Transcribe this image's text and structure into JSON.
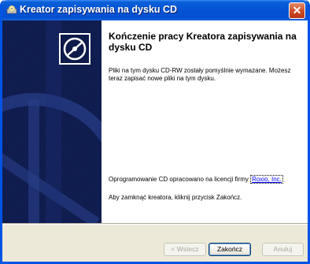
{
  "window": {
    "title": "Kreator zapisywania na dysku CD",
    "close_glyph": "✕"
  },
  "content": {
    "heading": "Kończenie pracy Kreatora zapisywania na dysku CD",
    "paragraph1": "Pliki na tym dysku CD-RW zostały pomyślnie wymazane. Możesz teraz zapisać nowe pliki na tym dysku.",
    "license_text": "Oprogramowanie CD opracowano na licencji firmy ",
    "license_link": "Roxio, Inc.",
    "close_instruction": "Aby zamknąć kreatora, kliknij przycisk Zakończ."
  },
  "buttons": {
    "back": "< Wstecz",
    "finish": "Zakończ",
    "cancel": "Anuluj"
  },
  "icons": {
    "title": "cd-burner-icon",
    "wizard": "cd-disc-icon"
  },
  "colors": {
    "titlebar": "#0453d5",
    "side_panel": "#0d1a4a",
    "link": "#0000ff",
    "window_bg": "#ece9d8"
  }
}
